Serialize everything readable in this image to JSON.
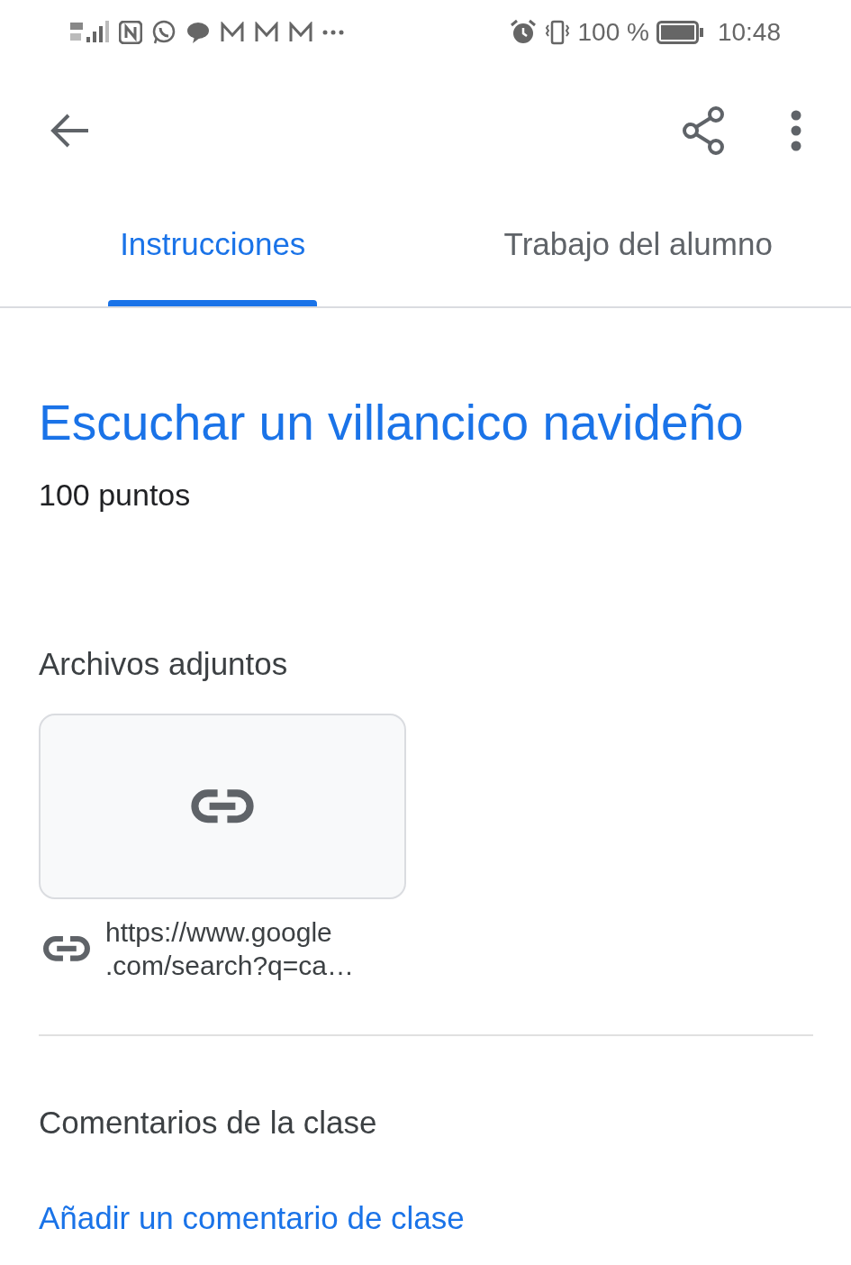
{
  "status_bar": {
    "battery": "100 %",
    "time": "10:48"
  },
  "tabs": [
    {
      "label": "Instrucciones",
      "selected": true
    },
    {
      "label": "Trabajo del alumno",
      "selected": false
    }
  ],
  "assignment": {
    "title": "Escuchar un villancico navideño",
    "points": "100 puntos"
  },
  "attachments": {
    "heading": "Archivos adjuntos",
    "items": [
      {
        "kind": "link",
        "link_lines": [
          "https://www.google",
          ".com/search?q=ca…"
        ]
      }
    ]
  },
  "comments": {
    "heading": "Comentarios de la clase",
    "add_link": "Añadir un comentario de clase"
  }
}
